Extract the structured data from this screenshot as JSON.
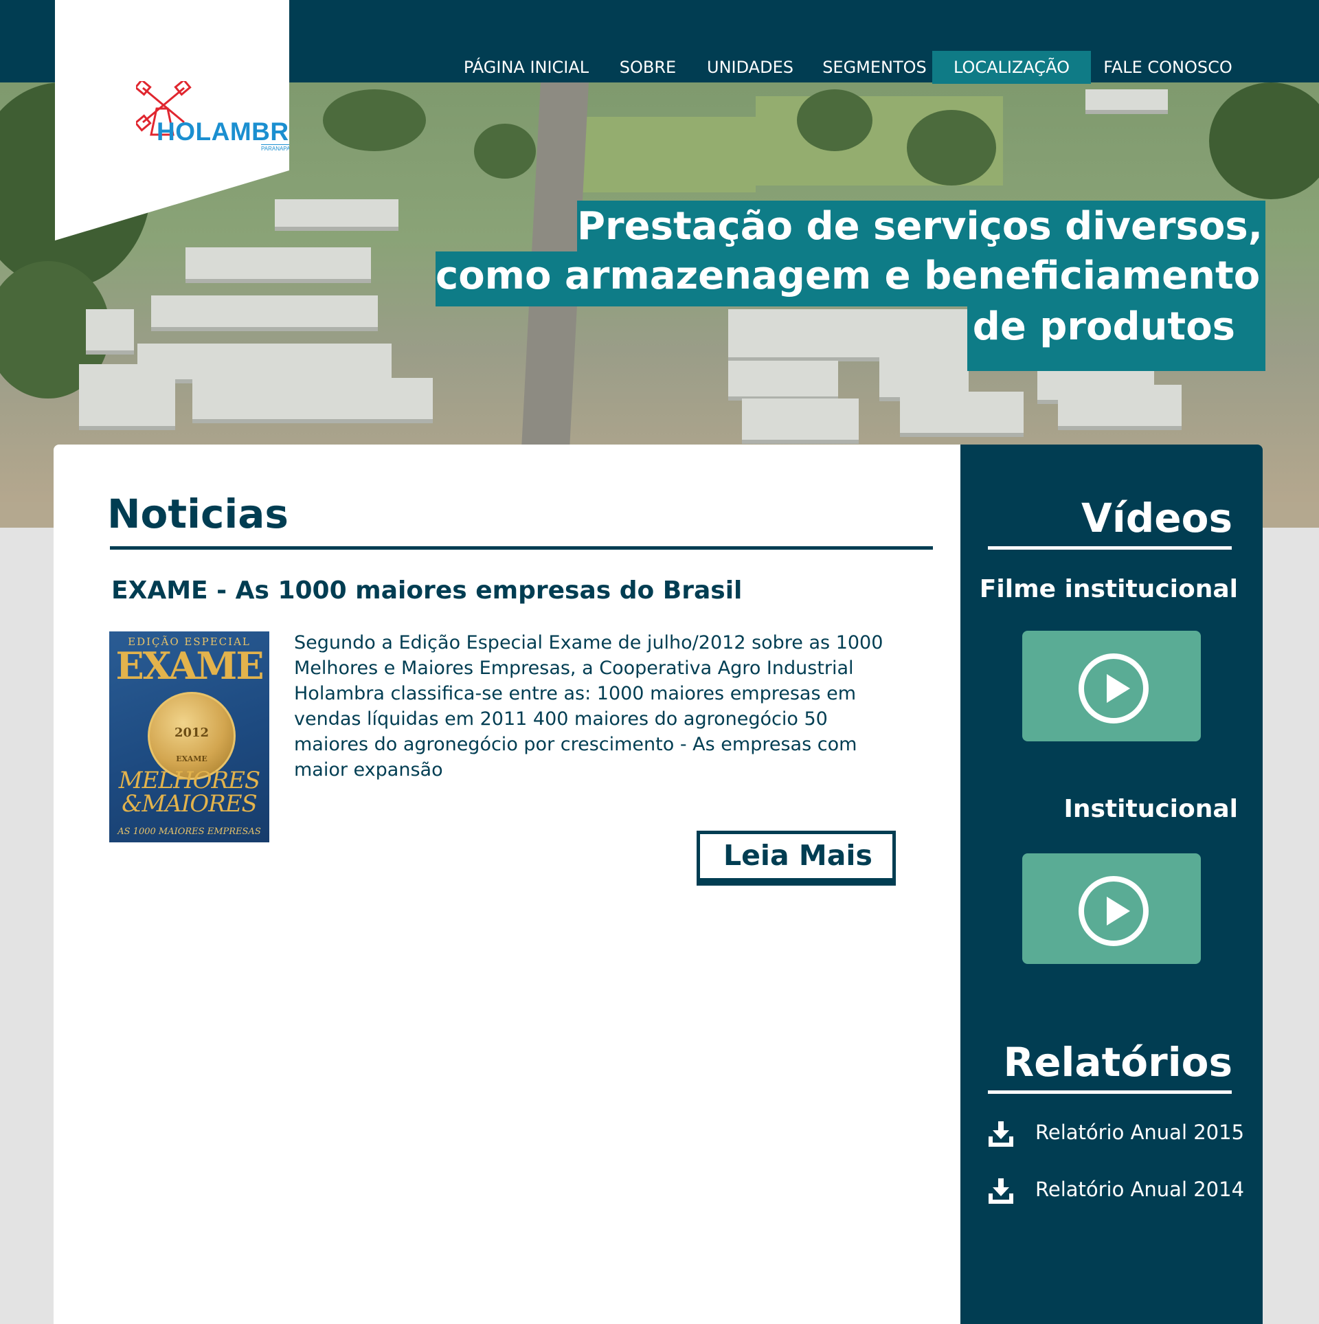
{
  "brand": {
    "logo_name": "HOLAMBRA",
    "logo_sub": "PARANAPANEMA - SP"
  },
  "nav": {
    "items": [
      {
        "label": "PÁGINA INICIAL"
      },
      {
        "label": "SOBRE"
      },
      {
        "label": "UNIDADES"
      },
      {
        "label": "SEGMENTOS"
      },
      {
        "label": "LOCALIZAÇÃO",
        "active": true
      },
      {
        "label": "FALE CONOSCO"
      }
    ]
  },
  "hero": {
    "lines": [
      "Prestação de serviços diversos,",
      "como armazenagem e beneficiamento",
      "de produtos"
    ]
  },
  "news": {
    "section_title": "Noticias",
    "article_title": "EXAME - As 1000 maiores empresas do Brasil",
    "body": "Segundo a Edição Especial Exame de julho/2012 sobre as 1000 Melhores e Maiores Empresas, a Cooperativa Agro Industrial Holambra classifica-se entre as: 1000 maiores empresas em vendas líquidas em 2011 400 maiores do agronegócio 50 maiores do agronegócio por crescimento - As empresas com maior expansão",
    "read_more_label": "Leia Mais",
    "magazine": {
      "edition": "EDIÇÃO ESPECIAL",
      "name": "EXAME",
      "year": "2012",
      "medal_brand": "EXAME",
      "headline_1": "MELHORES",
      "headline_2": "&MAIORES",
      "footer": "AS 1000 MAIORES EMPRESAS"
    }
  },
  "videos": {
    "section_title": "Vídeos",
    "items": [
      {
        "label": "Filme institucional"
      },
      {
        "label": "Institucional"
      }
    ]
  },
  "reports": {
    "section_title": "Relatórios",
    "items": [
      {
        "label": "Relatório Anual 2015"
      },
      {
        "label": "Relatório Anual 2014"
      }
    ]
  },
  "colors": {
    "navy": "#013d52",
    "teal": "#0e7c87",
    "video_green": "#5aac95",
    "logo_blue": "#1b8fd0",
    "logo_red": "#e0262f"
  }
}
